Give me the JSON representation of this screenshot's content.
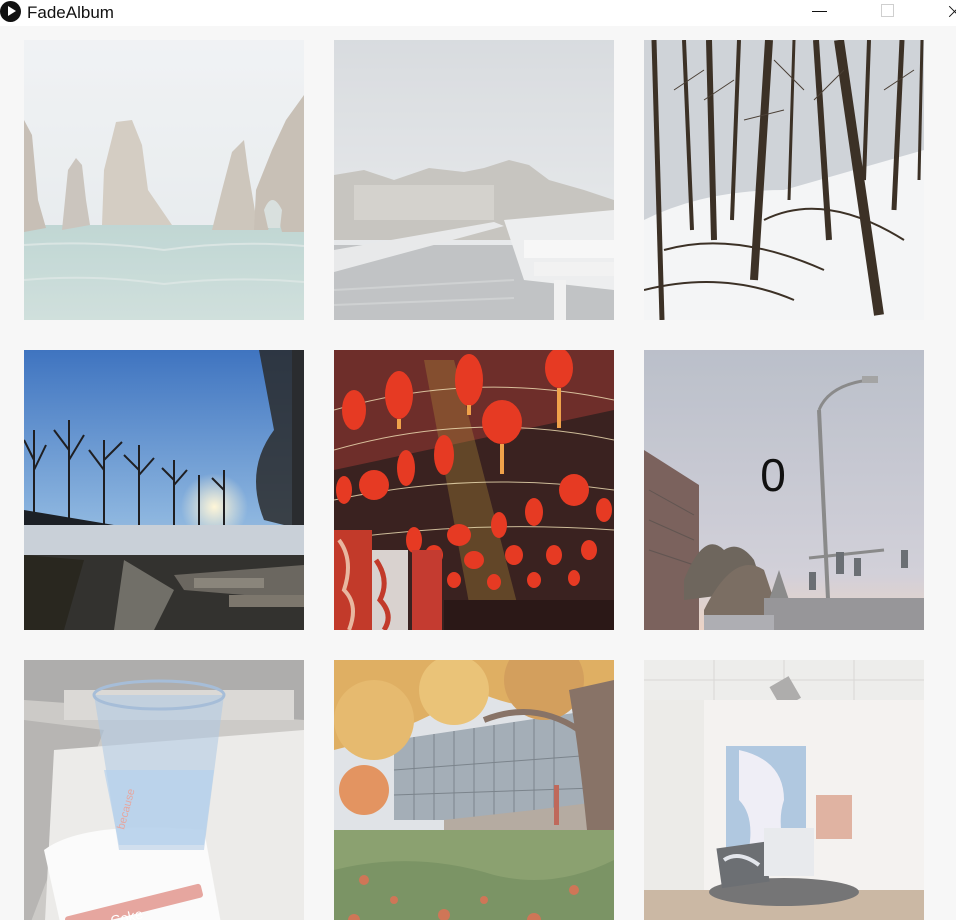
{
  "window": {
    "title": "FadeAlbum"
  },
  "album": {
    "photos": [
      {
        "name": "sea-arches",
        "fade": 0.35
      },
      {
        "name": "marina",
        "fade": 0.45
      },
      {
        "name": "snowy-forest",
        "fade": 0.0
      },
      {
        "name": "sunset-trees",
        "fade": 0.0
      },
      {
        "name": "red-lanterns",
        "fade": 0.0
      },
      {
        "name": "street-lamp",
        "fade": 0.2
      },
      {
        "name": "water-cup",
        "fade": 0.55
      },
      {
        "name": "autumn-building",
        "fade": 0.2
      },
      {
        "name": "gallery-installation",
        "fade": 0.3
      }
    ],
    "counter": "0"
  }
}
